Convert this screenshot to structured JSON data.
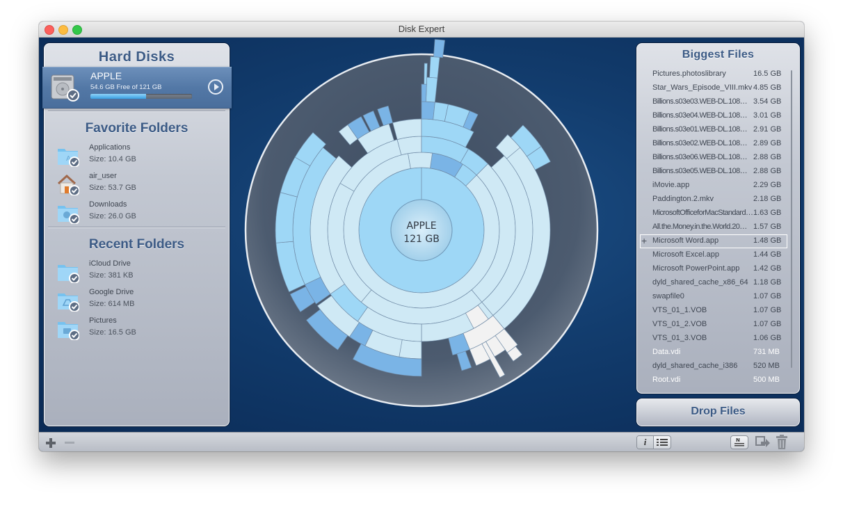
{
  "window": {
    "title": "Disk Expert"
  },
  "hard_disks": {
    "title": "Hard Disks",
    "disks": [
      {
        "name": "APPLE",
        "free_text": "54.6 GB Free of 121 GB",
        "used_fraction": 0.55,
        "icon": "hard-drive-icon",
        "action_icon": "play-circle-icon"
      }
    ]
  },
  "favorite_folders": {
    "title": "Favorite Folders",
    "items": [
      {
        "name": "Applications",
        "size": "Size: 10.4 GB",
        "icon": "applications-folder-icon"
      },
      {
        "name": "air_user",
        "size": "Size: 53.7 GB",
        "icon": "home-folder-icon"
      },
      {
        "name": "Downloads",
        "size": "Size: 26.0 GB",
        "icon": "downloads-folder-icon"
      }
    ]
  },
  "recent_folders": {
    "title": "Recent Folders",
    "items": [
      {
        "name": "iCloud Drive",
        "size": "Size: 381 KB",
        "icon": "folder-icon"
      },
      {
        "name": "Google Drive",
        "size": "Size: 614 MB",
        "icon": "google-drive-folder-icon"
      },
      {
        "name": "Pictures",
        "size": "Size: 16.5 GB",
        "icon": "pictures-folder-icon"
      }
    ]
  },
  "sunburst": {
    "center_label": "APPLE",
    "center_size": "121 GB",
    "colors": {
      "light": "#cfe9f5",
      "mid": "#9ed7f6",
      "dark": "#7ab4e6",
      "free": "#f2f2f2",
      "disc": "#4a5a6e"
    }
  },
  "biggest_files": {
    "title": "Biggest Files",
    "files": [
      {
        "name": "Pictures.photoslibrary",
        "size": "16.5 GB"
      },
      {
        "name": "Star_Wars_Episode_VIII.mkv",
        "size": "4.85 GB"
      },
      {
        "name": "Billions.s03e03.WEB-DL.108…",
        "size": "3.54 GB"
      },
      {
        "name": "Billions.s03e04.WEB-DL.108…",
        "size": "3.01 GB"
      },
      {
        "name": "Billions.s03e01.WEB-DL.108…",
        "size": "2.91 GB"
      },
      {
        "name": "Billions.s03e02.WEB-DL.108…",
        "size": "2.89 GB"
      },
      {
        "name": "Billions.s03e06.WEB-DL.108…",
        "size": "2.88 GB"
      },
      {
        "name": "Billions.s03e05.WEB-DL.108…",
        "size": "2.88 GB"
      },
      {
        "name": "iMovie.app",
        "size": "2.29 GB"
      },
      {
        "name": "Paddington.2.mkv",
        "size": "2.18 GB"
      },
      {
        "name": "MicrosoftOfficeforMacStandard…",
        "size": "1.63 GB"
      },
      {
        "name": "All.the.Money.in.the.World.20…",
        "size": "1.57 GB"
      },
      {
        "name": "Microsoft Word.app",
        "size": "1.48 GB",
        "selected": true
      },
      {
        "name": "Microsoft Excel.app",
        "size": "1.44 GB"
      },
      {
        "name": "Microsoft PowerPoint.app",
        "size": "1.42 GB"
      },
      {
        "name": "dyld_shared_cache_x86_64",
        "size": "1.18 GB"
      },
      {
        "name": "swapfile0",
        "size": "1.07 GB"
      },
      {
        "name": "VTS_01_1.VOB",
        "size": "1.07 GB"
      },
      {
        "name": "VTS_01_2.VOB",
        "size": "1.07 GB"
      },
      {
        "name": "VTS_01_3.VOB",
        "size": "1.06 GB"
      },
      {
        "name": "Data.vdi",
        "size": "731 MB"
      },
      {
        "name": "dyld_shared_cache_i386",
        "size": "520 MB"
      },
      {
        "name": "Root.vdi",
        "size": "500 MB"
      }
    ]
  },
  "drop_files": {
    "title": "Drop Files"
  },
  "toolbar": {
    "add_icon": "plus-icon",
    "remove_icon": "minus-icon",
    "info_label": "i",
    "list_icon": "list-icon",
    "note_icon": "note-icon",
    "note_label": "N",
    "move_icon": "move-icon",
    "trash_icon": "trash-icon"
  }
}
